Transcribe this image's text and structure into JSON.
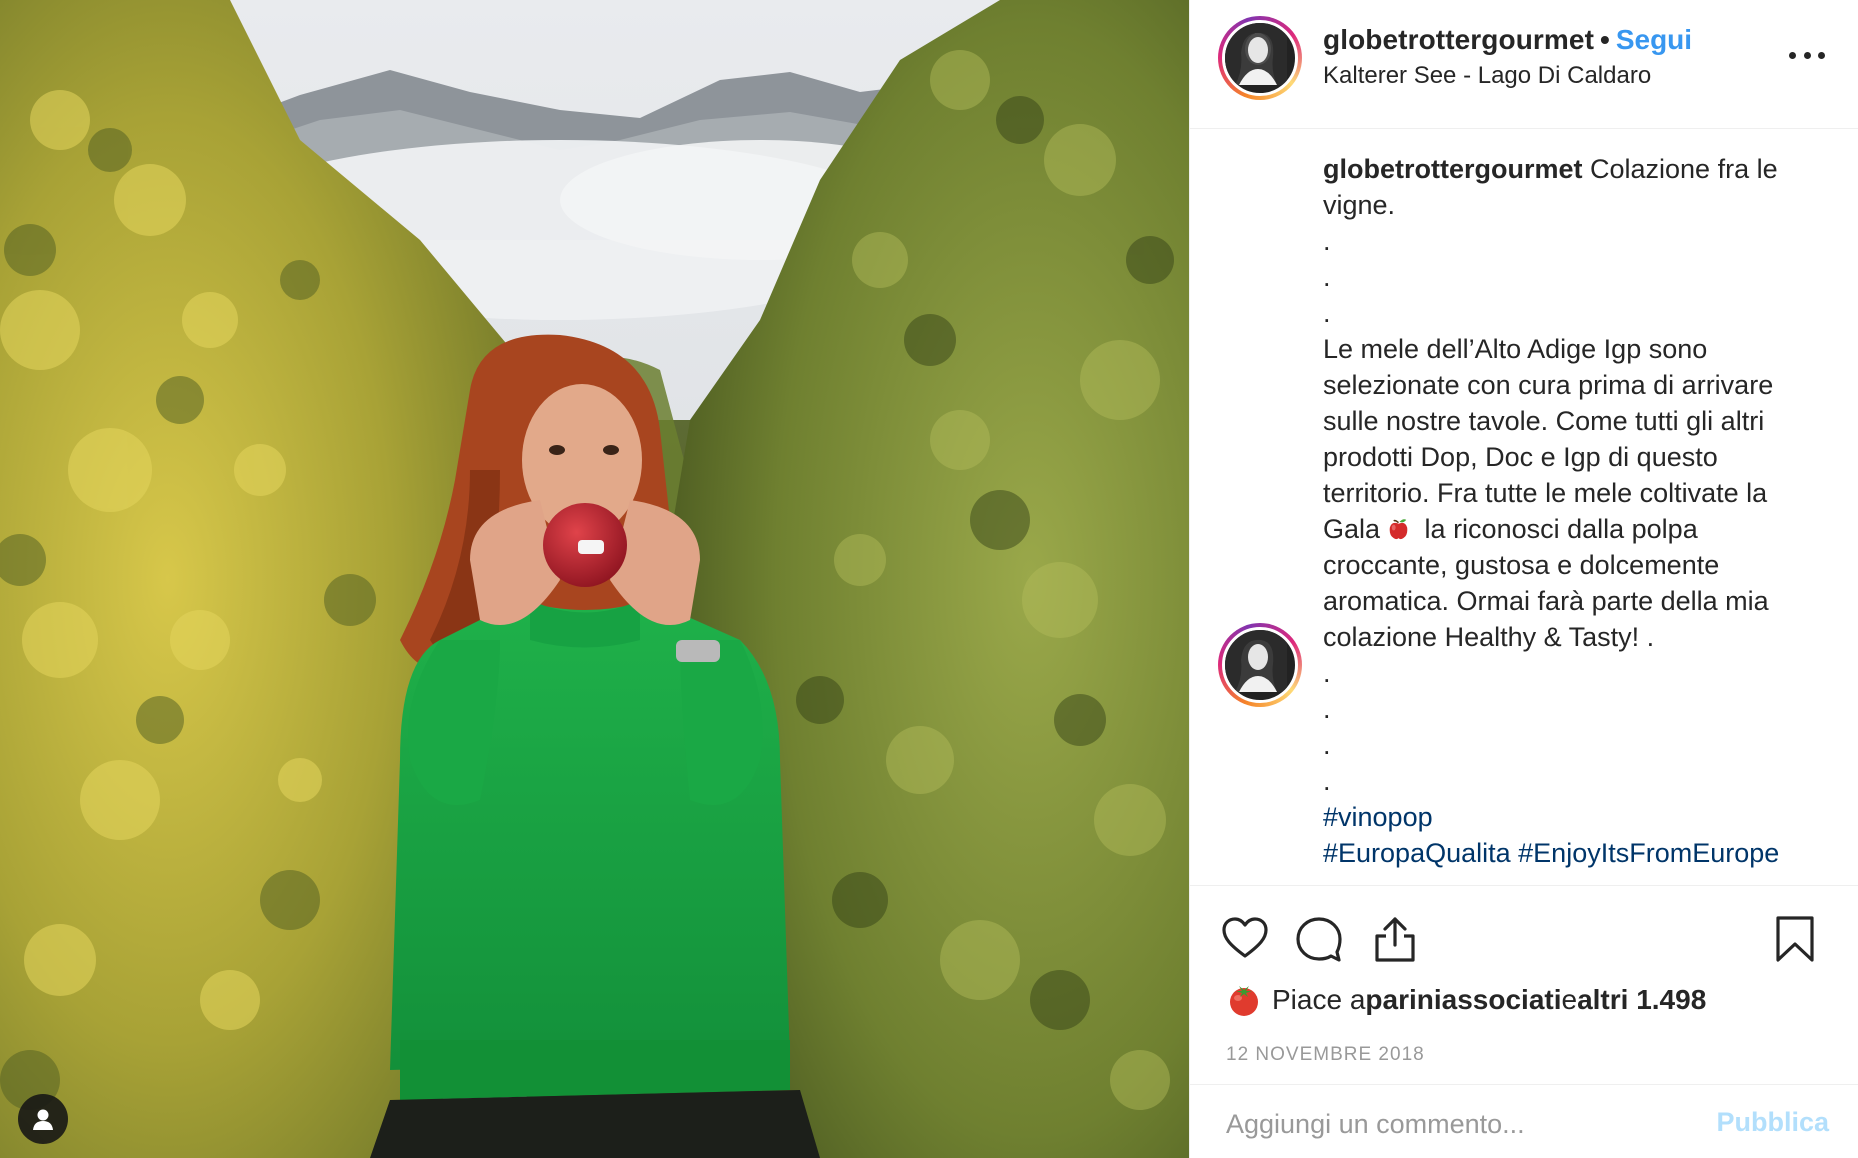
{
  "post": {
    "header": {
      "username": "globetrottergourmet",
      "separator": "•",
      "follow_label": "Segui",
      "location": "Kalterer See - Lago Di Caldaro",
      "avatar_icon": "profile-photo",
      "more_icon": "more-options-icon"
    },
    "caption": {
      "username": "globetrottergourmet",
      "line_1": " Colazione fra le vigne.\n.\n.\n.\nLe mele dell’Alto Adige Igp sono selezionate con cura prima di arrivare sulle nostre tavole. Come tutti gli altri prodotti Dop, Doc e Igp di questo territorio. Fra tutte le mele coltivate la Gala",
      "line_2": " la riconosci dalla polpa croccante, gustosa e dolcemente aromatica. Ormai farà parte della mia colazione Healthy & Tasty! .\n.\n.\n.\n.\n",
      "emoji": "red-apple",
      "hashtags": [
        "#vinopop",
        "#EuropaQualita",
        "#EnjoyItsFromEurope"
      ]
    },
    "actions": {
      "like_icon": "heart-icon",
      "comment_icon": "comment-icon",
      "share_icon": "share-icon",
      "save_icon": "bookmark-icon"
    },
    "likes": {
      "prefix": "Piace a ",
      "user": "pariniassociati",
      "middle": " e ",
      "count_text": "altri 1.498",
      "emoji": "tomato"
    },
    "date": "12 NOVEMBRE 2018",
    "comment": {
      "placeholder": "Aggiungi un commento...",
      "publish_label": "Pubblica"
    },
    "photo": {
      "tag_icon": "user-tag-icon"
    },
    "colors": {
      "link_blue": "#3897f0",
      "hashtag_blue": "#003569",
      "publish_disabled": "#b2dffc",
      "text": "#262626",
      "muted": "#999999"
    }
  }
}
